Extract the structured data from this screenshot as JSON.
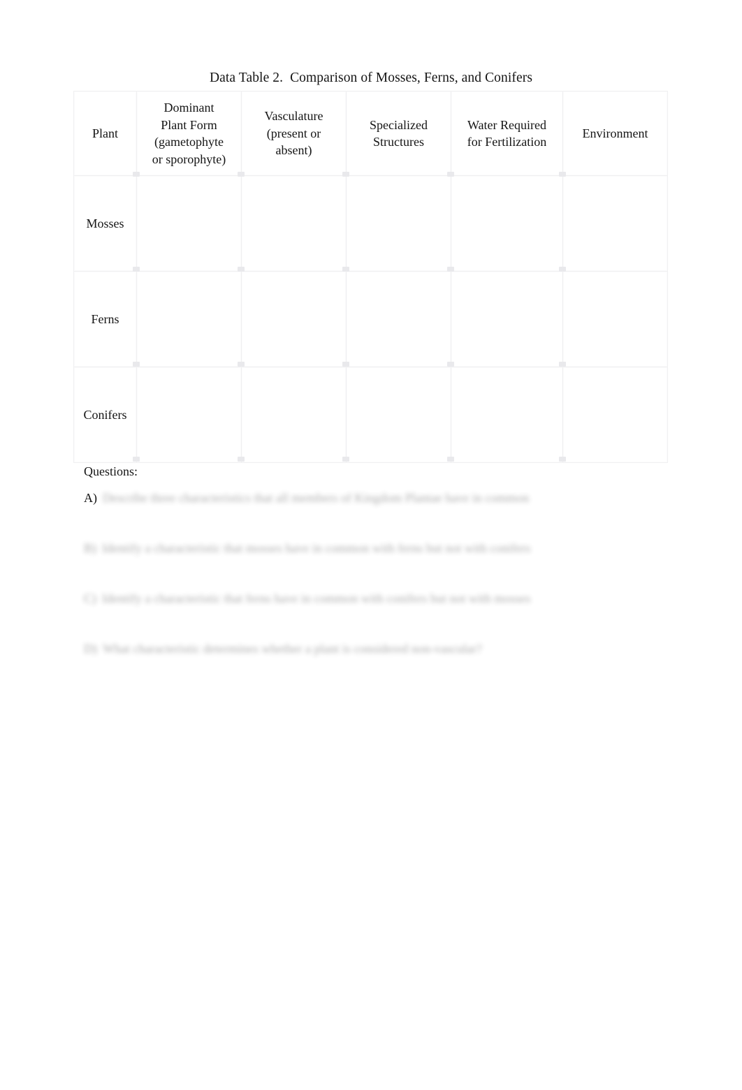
{
  "document": {
    "title": "Data Table 2.  Comparison of Mosses, Ferns, and Conifers",
    "background_color": "#ffffff",
    "text_color": "#141414",
    "grid_color": "#f0f0f1"
  },
  "table": {
    "name": "Data Table 2",
    "headers": [
      "Plant",
      "Dominant\nPlant Form\n(gametophyte\nor sporophyte)",
      "Vasculature\n(present or\nabsent)",
      "Specialized\nStructures",
      "Water Required\nfor Fertilization",
      "Environment"
    ],
    "rows": [
      {
        "label": "Mosses",
        "cells": [
          "",
          "",
          "",
          "",
          ""
        ]
      },
      {
        "label": "Ferns",
        "cells": [
          "",
          "",
          "",
          "",
          ""
        ]
      },
      {
        "label": "Conifers",
        "cells": [
          "",
          "",
          "",
          "",
          ""
        ]
      }
    ]
  },
  "questions": {
    "heading": "Questions:",
    "items": [
      {
        "marker": "A)",
        "marker_legible": true,
        "text": "Describe three characteristics that all members of Kingdom Plantae have in common",
        "legible": false
      },
      {
        "marker": "B)",
        "marker_legible": false,
        "text": "Identify a characteristic that mosses have in common with ferns but not with conifers",
        "legible": false
      },
      {
        "marker": "C)",
        "marker_legible": false,
        "text": "Identify a characteristic that ferns have in common with conifers but not with mosses",
        "legible": false
      },
      {
        "marker": "D)",
        "marker_legible": false,
        "text": "What characteristic determines whether a plant is considered non-vascular?",
        "legible": false
      }
    ]
  }
}
